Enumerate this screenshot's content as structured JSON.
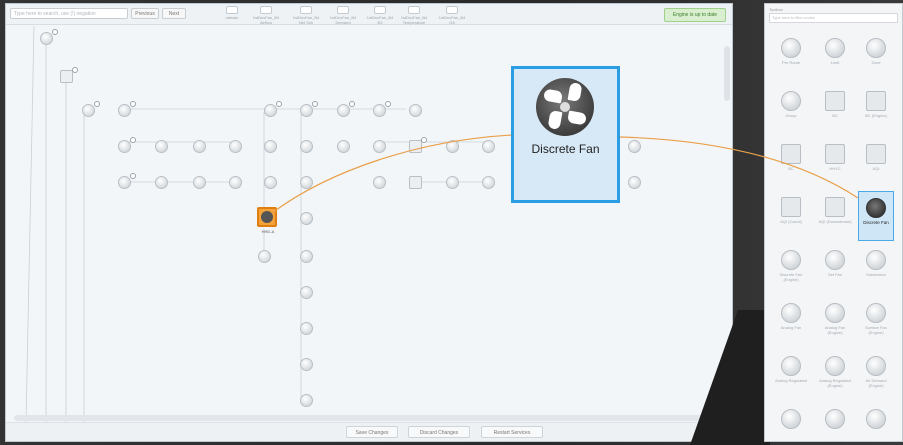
{
  "toolbar": {
    "search_placeholder": "Type here to search, use (!) negation",
    "btn_1": "Previous",
    "btn_2": "Next",
    "status": "Engine is up to date",
    "top_nodes": [
      "obtusle",
      "1stDuvFan_B4 Airflow",
      "1stDuvFan_B4 Net Sch",
      "1stDuvFan_B4 Demand",
      "1stDuvFan_B4 B3",
      "1stDuvFan_B4 Temperature",
      "1stDuvFan_B4 OA"
    ]
  },
  "bottom_bar": {
    "save": "Save Changes",
    "discard": "Discard Changes",
    "restart": "Restart Services"
  },
  "selected_node_label": "HHD-A",
  "callout": {
    "label": "Discrete Fan"
  },
  "palette": {
    "title": "Toolbox",
    "search_placeholder": "Type here to filter nodes",
    "items": [
      {
        "label": "Pre Route"
      },
      {
        "label": "Limit"
      },
      {
        "label": "Zone"
      },
      {
        "label": "Group"
      },
      {
        "label": "BC"
      },
      {
        "label": "BC (Engine)"
      },
      {
        "label": "BC"
      },
      {
        "label": "HHVC"
      },
      {
        "label": "AQI"
      },
      {
        "label": "AQI (Carrot)"
      },
      {
        "label": "AQI (Downstream)"
      },
      {
        "label": "Discrete Fan"
      },
      {
        "label": "Discrete Fan (Engine)"
      },
      {
        "label": "Set Fan"
      },
      {
        "label": "Subsection"
      },
      {
        "label": "Analog Fan"
      },
      {
        "label": "Analog Fan (Engine)"
      },
      {
        "label": "Surface Fan (Engine)"
      },
      {
        "label": "Analog Regulated"
      },
      {
        "label": "Analog Regulated (Engine)"
      },
      {
        "label": "Air Demand (Engine)"
      },
      {
        "label": ""
      },
      {
        "label": ""
      },
      {
        "label": ""
      }
    ]
  },
  "colors": {
    "accent": "#2a9de3",
    "selection": "#f4a23a",
    "wire": "#e9a04a"
  }
}
